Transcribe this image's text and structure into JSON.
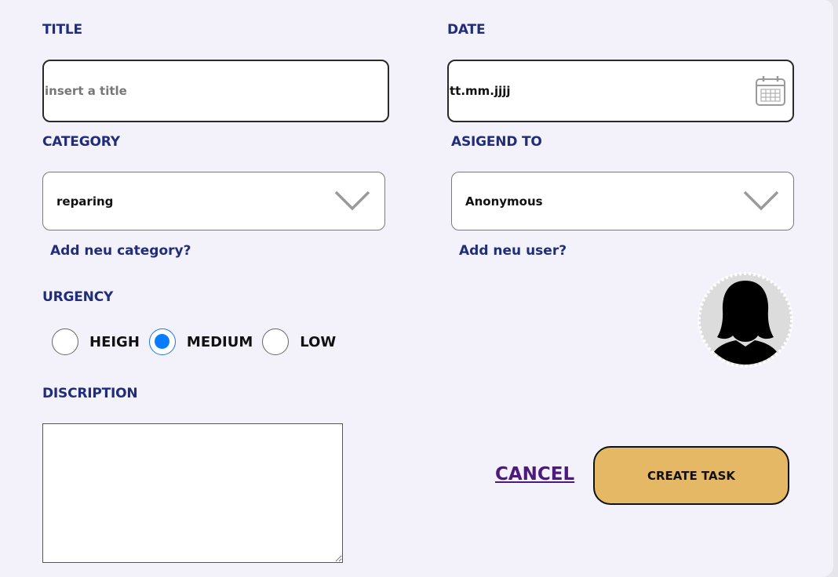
{
  "form": {
    "title_label": "TITLE",
    "title_placeholder": "insert a title",
    "date_label": "DATE",
    "date_value": "tt.mm.jjjj",
    "category_label": "CATEGORY",
    "category_value": "reparing",
    "add_category_link": "Add neu category?",
    "assigned_label": "ASIGEND TO",
    "assigned_value": "Anonymous",
    "add_user_link": "Add neu user?",
    "urgency_label": "URGENCY",
    "urgency_options": [
      "HEIGH",
      "MEDIUM",
      "LOW"
    ],
    "urgency_selected": "MEDIUM",
    "description_label": "DISCRIPTION",
    "description_value": ""
  },
  "actions": {
    "cancel_label": "CANCEL",
    "create_label": "CREATE TASK"
  },
  "icons": {
    "date": "calendar-icon",
    "select": "chevron-down-icon",
    "avatar": "user-silhouette-icon"
  },
  "colors": {
    "label": "#1f2d7a",
    "accent_radio": "#0a7cff",
    "create_button": "#e4b865",
    "cancel_link": "#4b1a7a"
  }
}
